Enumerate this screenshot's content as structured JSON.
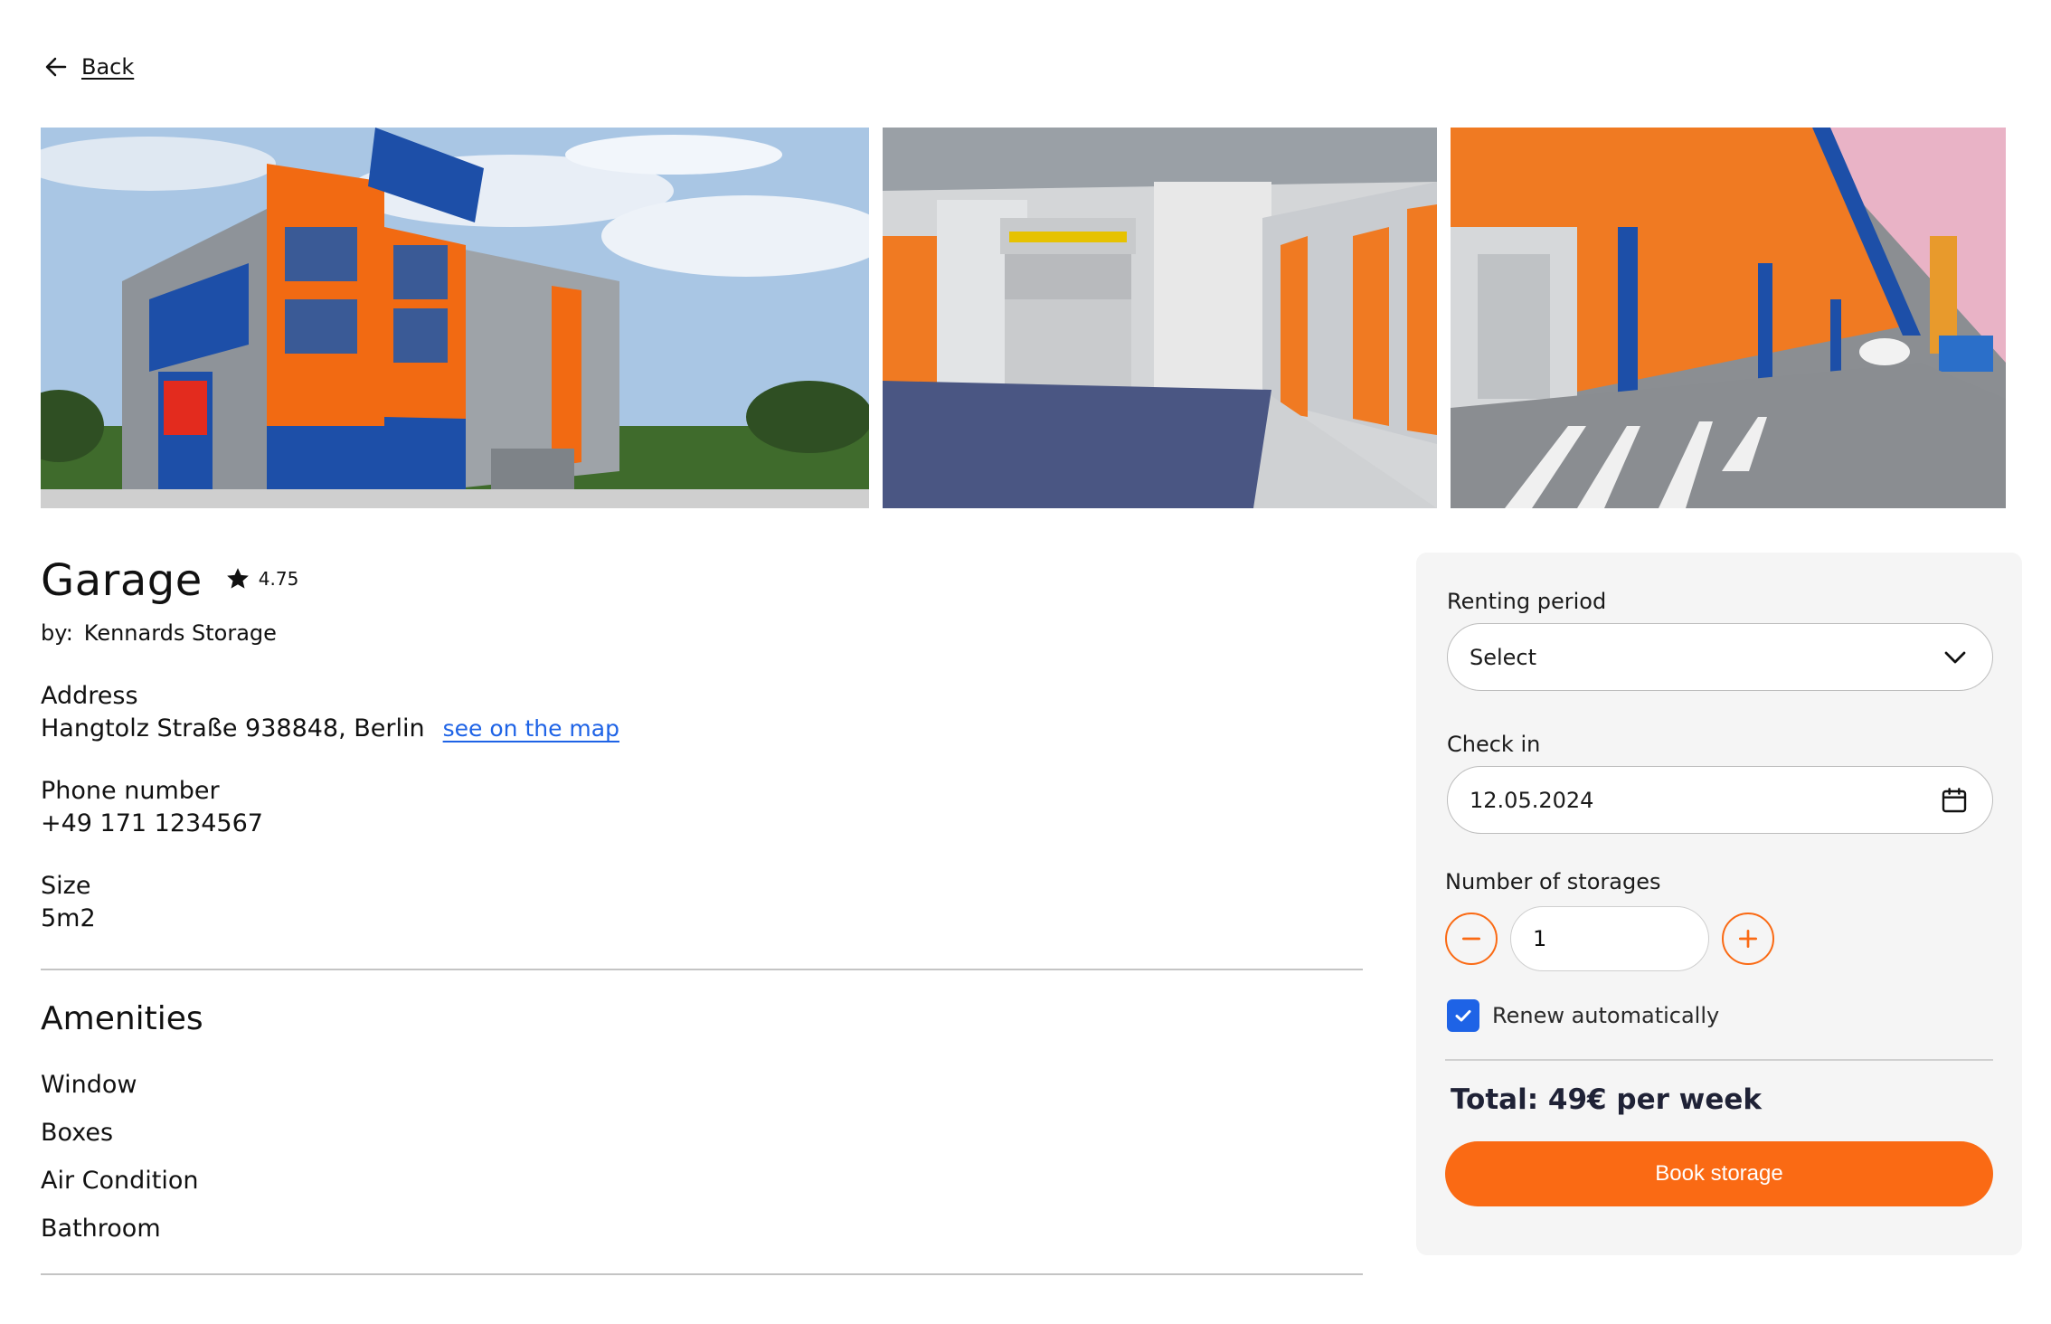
{
  "nav": {
    "back_label": "Back"
  },
  "listing": {
    "title": "Garage",
    "rating": "4.75",
    "owner_prefix": "by:",
    "owner_name": "Kennards Storage",
    "address_label": "Address",
    "address_value": "Hangtolz Straße 938848, Berlin",
    "map_link": "see on the map",
    "phone_label": "Phone number",
    "phone_value": "+49 171 1234567",
    "size_label": "Size",
    "size_value": "5m2"
  },
  "amenities": {
    "title": "Amenities",
    "items": [
      "Window",
      "Boxes",
      "Air Condition",
      "Bathroom"
    ]
  },
  "booking": {
    "period_label": "Renting period",
    "period_value": "Select",
    "checkin_label": "Check in",
    "checkin_value": "12.05.2024",
    "storages_label": "Number of storages",
    "storages_value": "1",
    "renew_label": "Renew automatically",
    "renew_checked": true,
    "total": "Total: 49€ per week",
    "book_label": "Book storage"
  },
  "colors": {
    "accent": "#fa6a14",
    "link": "#1e63e6",
    "brand_blue": "#1d4fa8"
  },
  "icons": [
    "back-arrow-icon",
    "star-icon",
    "chevron-down-icon",
    "calendar-icon",
    "minus-icon",
    "plus-icon",
    "checkmark-icon"
  ]
}
